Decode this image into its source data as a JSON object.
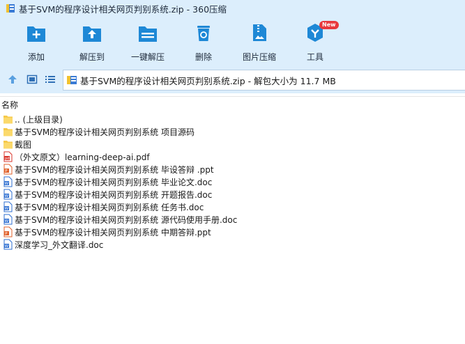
{
  "window": {
    "title": "基于SVM的程序设计相关网页判别系统.zip - 360压缩"
  },
  "toolbar": {
    "items": [
      {
        "label": "添加",
        "icon": "add-icon"
      },
      {
        "label": "解压到",
        "icon": "extract-to-icon"
      },
      {
        "label": "一键解压",
        "icon": "one-click-extract-icon"
      },
      {
        "label": "删除",
        "icon": "delete-icon"
      },
      {
        "label": "图片压缩",
        "icon": "image-compress-icon"
      },
      {
        "label": "工具",
        "icon": "tools-icon",
        "badge": "New"
      }
    ]
  },
  "address": {
    "path": "基于SVM的程序设计相关网页判别系统.zip - 解包大小为 11.7 MB"
  },
  "list": {
    "header": "名称",
    "files": [
      {
        "name": ".. (上级目录)",
        "type": "folder"
      },
      {
        "name": "基于SVM的程序设计相关网页判别系统 项目源码",
        "type": "folder"
      },
      {
        "name": "截图",
        "type": "folder"
      },
      {
        "name": "（外文原文）learning-deep-ai.pdf",
        "type": "pdf"
      },
      {
        "name": "基于SVM的程序设计相关网页判别系统 毕设答辩 .ppt",
        "type": "ppt"
      },
      {
        "name": "基于SVM的程序设计相关网页判别系统 毕业论文.doc",
        "type": "doc"
      },
      {
        "name": "基于SVM的程序设计相关网页判别系统 开题报告.doc",
        "type": "doc"
      },
      {
        "name": "基于SVM的程序设计相关网页判别系统 任务书.doc",
        "type": "doc"
      },
      {
        "name": "基于SVM的程序设计相关网页判别系统 源代码使用手册.doc",
        "type": "doc"
      },
      {
        "name": "基于SVM的程序设计相关网页判别系统 中期答辩.ppt",
        "type": "ppt"
      },
      {
        "name": "深度学习_外文翻译.doc",
        "type": "doc"
      }
    ]
  },
  "colors": {
    "accent": "#1e88d6",
    "bar_bg": "#dceefc",
    "folder": "#f6c94a",
    "pdf": "#d9342b",
    "ppt": "#e0612b",
    "doc": "#2f6fd1"
  }
}
